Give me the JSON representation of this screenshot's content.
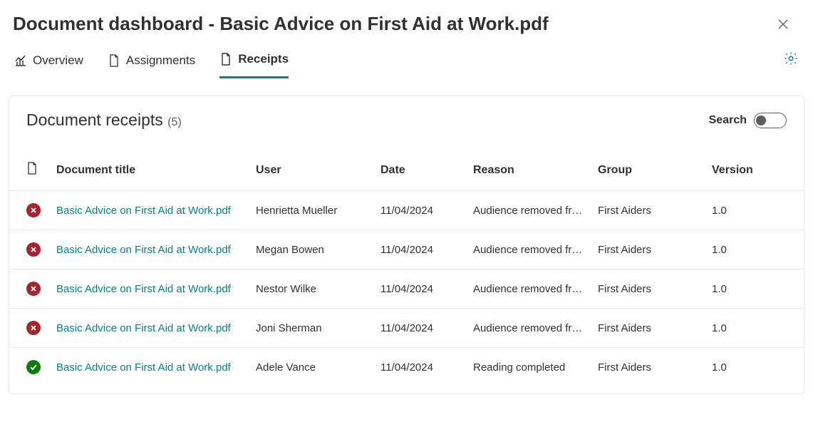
{
  "header": {
    "title": "Document dashboard - Basic Advice on First Aid at Work.pdf"
  },
  "tabs": {
    "overview": {
      "label": "Overview"
    },
    "assignments": {
      "label": "Assignments"
    },
    "receipts": {
      "label": "Receipts"
    }
  },
  "panel": {
    "title": "Document receipts",
    "count": "(5)",
    "search_label": "Search"
  },
  "columns": {
    "title": "Document title",
    "user": "User",
    "date": "Date",
    "reason": "Reason",
    "group": "Group",
    "version": "Version"
  },
  "rows": [
    {
      "status": "bad",
      "title": "Basic Advice on First Aid at Work.pdf",
      "user": "Henrietta Mueller",
      "date": "11/04/2024",
      "reason": "Audience removed fr…",
      "group": "First Aiders",
      "version": "1.0"
    },
    {
      "status": "bad",
      "title": "Basic Advice on First Aid at Work.pdf",
      "user": "Megan Bowen",
      "date": "11/04/2024",
      "reason": "Audience removed fr…",
      "group": "First Aiders",
      "version": "1.0"
    },
    {
      "status": "bad",
      "title": "Basic Advice on First Aid at Work.pdf",
      "user": "Nestor Wilke",
      "date": "11/04/2024",
      "reason": "Audience removed fr…",
      "group": "First Aiders",
      "version": "1.0"
    },
    {
      "status": "bad",
      "title": "Basic Advice on First Aid at Work.pdf",
      "user": "Joni Sherman",
      "date": "11/04/2024",
      "reason": "Audience removed fr…",
      "group": "First Aiders",
      "version": "1.0"
    },
    {
      "status": "good",
      "title": "Basic Advice on First Aid at Work.pdf",
      "user": "Adele Vance",
      "date": "11/04/2024",
      "reason": "Reading completed",
      "group": "First Aiders",
      "version": "1.0"
    }
  ]
}
